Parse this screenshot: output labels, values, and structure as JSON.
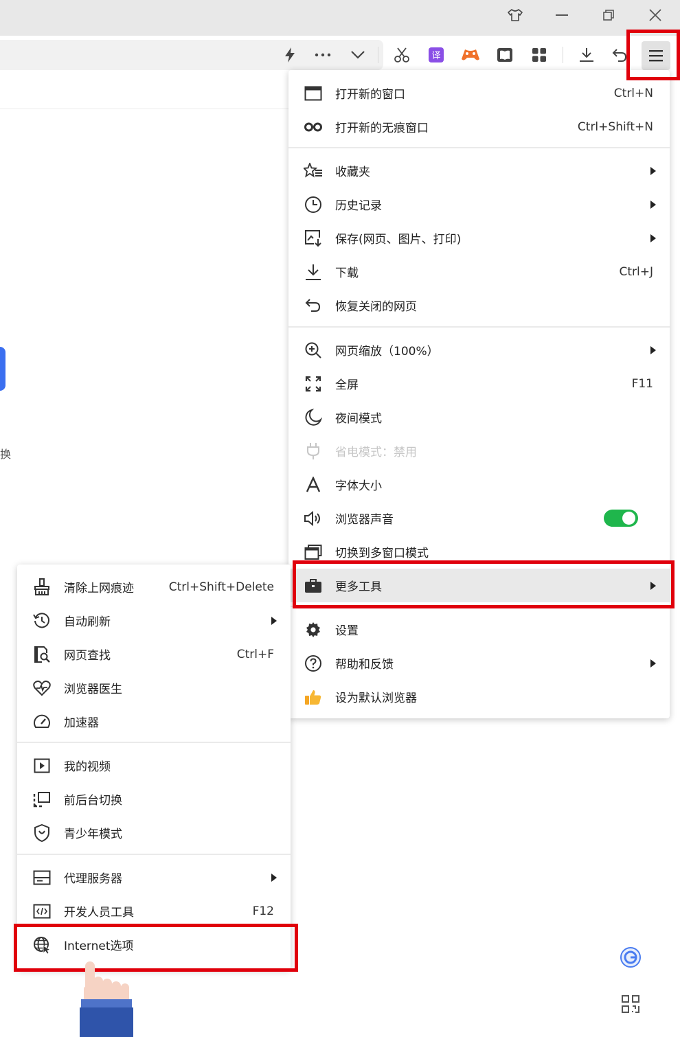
{
  "main_menu": {
    "group1": [
      {
        "label": "打开新的窗口",
        "shortcut": "Ctrl+N",
        "icon": "window-icon"
      },
      {
        "label": "打开新的无痕窗口",
        "shortcut": "Ctrl+Shift+N",
        "icon": "incognito-icon"
      }
    ],
    "group2": [
      {
        "label": "收藏夹",
        "icon": "star-list-icon",
        "submenu": true
      },
      {
        "label": "历史记录",
        "icon": "clock-icon",
        "submenu": true
      },
      {
        "label": "保存(网页、图片、打印)",
        "icon": "save-page-icon",
        "submenu": true
      },
      {
        "label": "下载",
        "shortcut": "Ctrl+J",
        "icon": "download-icon"
      },
      {
        "label": "恢复关闭的网页",
        "icon": "undo-icon"
      }
    ],
    "group3": [
      {
        "label": "网页缩放（100%）",
        "icon": "zoom-icon",
        "submenu": true
      },
      {
        "label": "全屏",
        "shortcut": "F11",
        "icon": "fullscreen-icon"
      },
      {
        "label": "夜间模式",
        "icon": "moon-icon"
      },
      {
        "label": "省电模式：禁用",
        "icon": "plug-icon",
        "disabled": true
      },
      {
        "label": "字体大小",
        "icon": "font-icon"
      },
      {
        "label": "浏览器声音",
        "icon": "speaker-icon",
        "toggle": true
      },
      {
        "label": "切换到多窗口模式",
        "icon": "multi-window-icon"
      },
      {
        "label": "更多工具",
        "icon": "toolbox-icon",
        "submenu": true,
        "active": true
      }
    ],
    "group4": [
      {
        "label": "设置",
        "icon": "gear-icon"
      },
      {
        "label": "帮助和反馈",
        "icon": "help-icon",
        "submenu": true
      },
      {
        "label": "设为默认浏览器",
        "icon": "thumbs-up-icon"
      }
    ]
  },
  "tools_menu": {
    "group1": [
      {
        "label": "清除上网痕迹",
        "shortcut": "Ctrl+Shift+Delete",
        "icon": "broom-icon"
      },
      {
        "label": "自动刷新",
        "icon": "refresh-clock-icon",
        "submenu": true
      },
      {
        "label": "网页查找",
        "shortcut": "Ctrl+F",
        "icon": "find-page-icon"
      },
      {
        "label": "浏览器医生",
        "icon": "heart-pulse-icon"
      },
      {
        "label": "加速器",
        "icon": "speedometer-icon"
      }
    ],
    "group2": [
      {
        "label": "我的视频",
        "icon": "video-icon"
      },
      {
        "label": "前后台切换",
        "icon": "switch-icon"
      },
      {
        "label": "青少年模式",
        "icon": "shield-icon"
      }
    ],
    "group3": [
      {
        "label": "代理服务器",
        "icon": "proxy-icon",
        "submenu": true
      },
      {
        "label": "开发人员工具",
        "shortcut": "F12",
        "icon": "code-icon"
      },
      {
        "label": "Internet选项",
        "icon": "globe-icon"
      }
    ]
  },
  "page": {
    "partial_text": "换"
  },
  "colors": {
    "highlight": "#e0000b",
    "toggle_on": "#1fb64c",
    "accent_blue": "#3b6ff0"
  }
}
